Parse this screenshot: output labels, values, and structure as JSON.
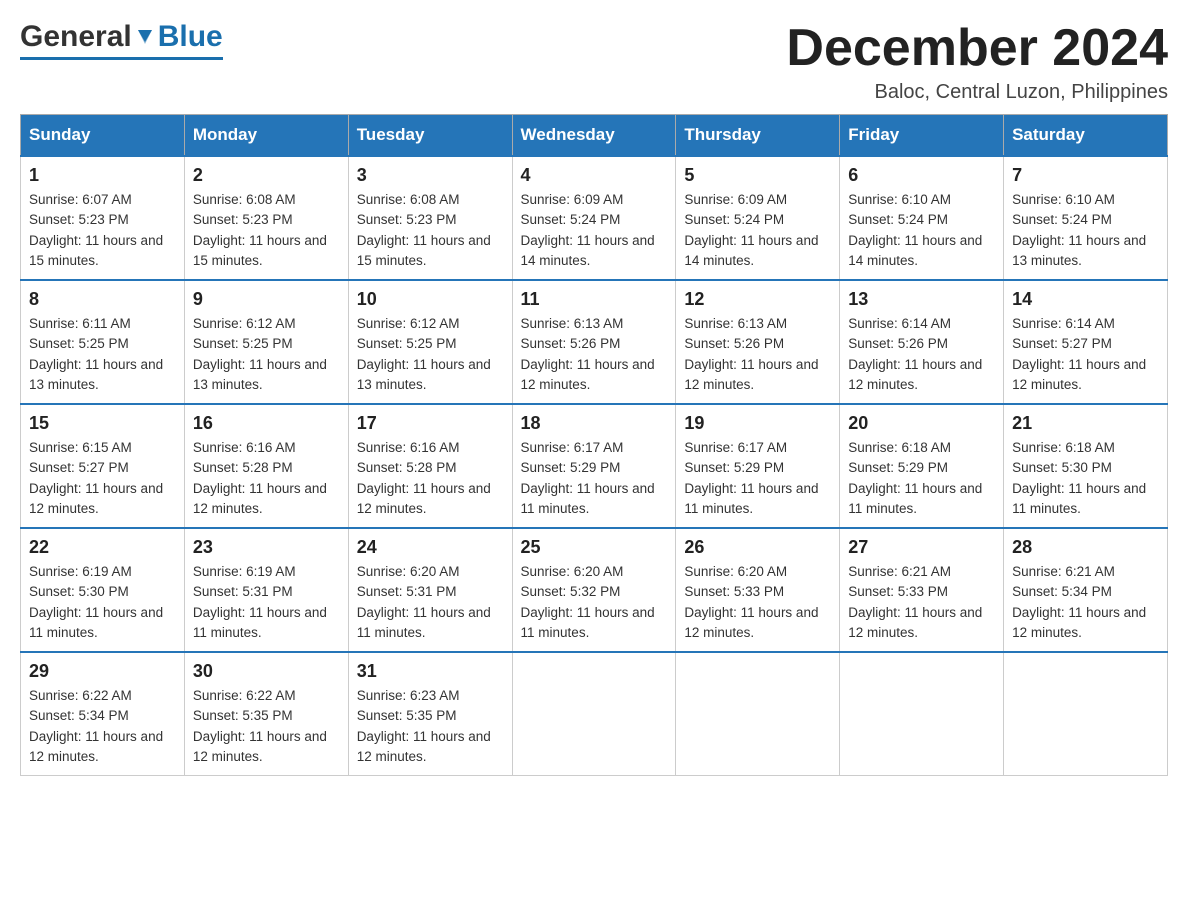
{
  "header": {
    "logo_general": "General",
    "logo_blue": "Blue",
    "month_year": "December 2024",
    "location": "Baloc, Central Luzon, Philippines"
  },
  "days_of_week": [
    "Sunday",
    "Monday",
    "Tuesday",
    "Wednesday",
    "Thursday",
    "Friday",
    "Saturday"
  ],
  "weeks": [
    [
      {
        "day": "1",
        "sunrise": "6:07 AM",
        "sunset": "5:23 PM",
        "daylight": "11 hours and 15 minutes."
      },
      {
        "day": "2",
        "sunrise": "6:08 AM",
        "sunset": "5:23 PM",
        "daylight": "11 hours and 15 minutes."
      },
      {
        "day": "3",
        "sunrise": "6:08 AM",
        "sunset": "5:23 PM",
        "daylight": "11 hours and 15 minutes."
      },
      {
        "day": "4",
        "sunrise": "6:09 AM",
        "sunset": "5:24 PM",
        "daylight": "11 hours and 14 minutes."
      },
      {
        "day": "5",
        "sunrise": "6:09 AM",
        "sunset": "5:24 PM",
        "daylight": "11 hours and 14 minutes."
      },
      {
        "day": "6",
        "sunrise": "6:10 AM",
        "sunset": "5:24 PM",
        "daylight": "11 hours and 14 minutes."
      },
      {
        "day": "7",
        "sunrise": "6:10 AM",
        "sunset": "5:24 PM",
        "daylight": "11 hours and 13 minutes."
      }
    ],
    [
      {
        "day": "8",
        "sunrise": "6:11 AM",
        "sunset": "5:25 PM",
        "daylight": "11 hours and 13 minutes."
      },
      {
        "day": "9",
        "sunrise": "6:12 AM",
        "sunset": "5:25 PM",
        "daylight": "11 hours and 13 minutes."
      },
      {
        "day": "10",
        "sunrise": "6:12 AM",
        "sunset": "5:25 PM",
        "daylight": "11 hours and 13 minutes."
      },
      {
        "day": "11",
        "sunrise": "6:13 AM",
        "sunset": "5:26 PM",
        "daylight": "11 hours and 12 minutes."
      },
      {
        "day": "12",
        "sunrise": "6:13 AM",
        "sunset": "5:26 PM",
        "daylight": "11 hours and 12 minutes."
      },
      {
        "day": "13",
        "sunrise": "6:14 AM",
        "sunset": "5:26 PM",
        "daylight": "11 hours and 12 minutes."
      },
      {
        "day": "14",
        "sunrise": "6:14 AM",
        "sunset": "5:27 PM",
        "daylight": "11 hours and 12 minutes."
      }
    ],
    [
      {
        "day": "15",
        "sunrise": "6:15 AM",
        "sunset": "5:27 PM",
        "daylight": "11 hours and 12 minutes."
      },
      {
        "day": "16",
        "sunrise": "6:16 AM",
        "sunset": "5:28 PM",
        "daylight": "11 hours and 12 minutes."
      },
      {
        "day": "17",
        "sunrise": "6:16 AM",
        "sunset": "5:28 PM",
        "daylight": "11 hours and 12 minutes."
      },
      {
        "day": "18",
        "sunrise": "6:17 AM",
        "sunset": "5:29 PM",
        "daylight": "11 hours and 11 minutes."
      },
      {
        "day": "19",
        "sunrise": "6:17 AM",
        "sunset": "5:29 PM",
        "daylight": "11 hours and 11 minutes."
      },
      {
        "day": "20",
        "sunrise": "6:18 AM",
        "sunset": "5:29 PM",
        "daylight": "11 hours and 11 minutes."
      },
      {
        "day": "21",
        "sunrise": "6:18 AM",
        "sunset": "5:30 PM",
        "daylight": "11 hours and 11 minutes."
      }
    ],
    [
      {
        "day": "22",
        "sunrise": "6:19 AM",
        "sunset": "5:30 PM",
        "daylight": "11 hours and 11 minutes."
      },
      {
        "day": "23",
        "sunrise": "6:19 AM",
        "sunset": "5:31 PM",
        "daylight": "11 hours and 11 minutes."
      },
      {
        "day": "24",
        "sunrise": "6:20 AM",
        "sunset": "5:31 PM",
        "daylight": "11 hours and 11 minutes."
      },
      {
        "day": "25",
        "sunrise": "6:20 AM",
        "sunset": "5:32 PM",
        "daylight": "11 hours and 11 minutes."
      },
      {
        "day": "26",
        "sunrise": "6:20 AM",
        "sunset": "5:33 PM",
        "daylight": "11 hours and 12 minutes."
      },
      {
        "day": "27",
        "sunrise": "6:21 AM",
        "sunset": "5:33 PM",
        "daylight": "11 hours and 12 minutes."
      },
      {
        "day": "28",
        "sunrise": "6:21 AM",
        "sunset": "5:34 PM",
        "daylight": "11 hours and 12 minutes."
      }
    ],
    [
      {
        "day": "29",
        "sunrise": "6:22 AM",
        "sunset": "5:34 PM",
        "daylight": "11 hours and 12 minutes."
      },
      {
        "day": "30",
        "sunrise": "6:22 AM",
        "sunset": "5:35 PM",
        "daylight": "11 hours and 12 minutes."
      },
      {
        "day": "31",
        "sunrise": "6:23 AM",
        "sunset": "5:35 PM",
        "daylight": "11 hours and 12 minutes."
      },
      null,
      null,
      null,
      null
    ]
  ],
  "labels": {
    "sunrise": "Sunrise:",
    "sunset": "Sunset:",
    "daylight": "Daylight:"
  }
}
